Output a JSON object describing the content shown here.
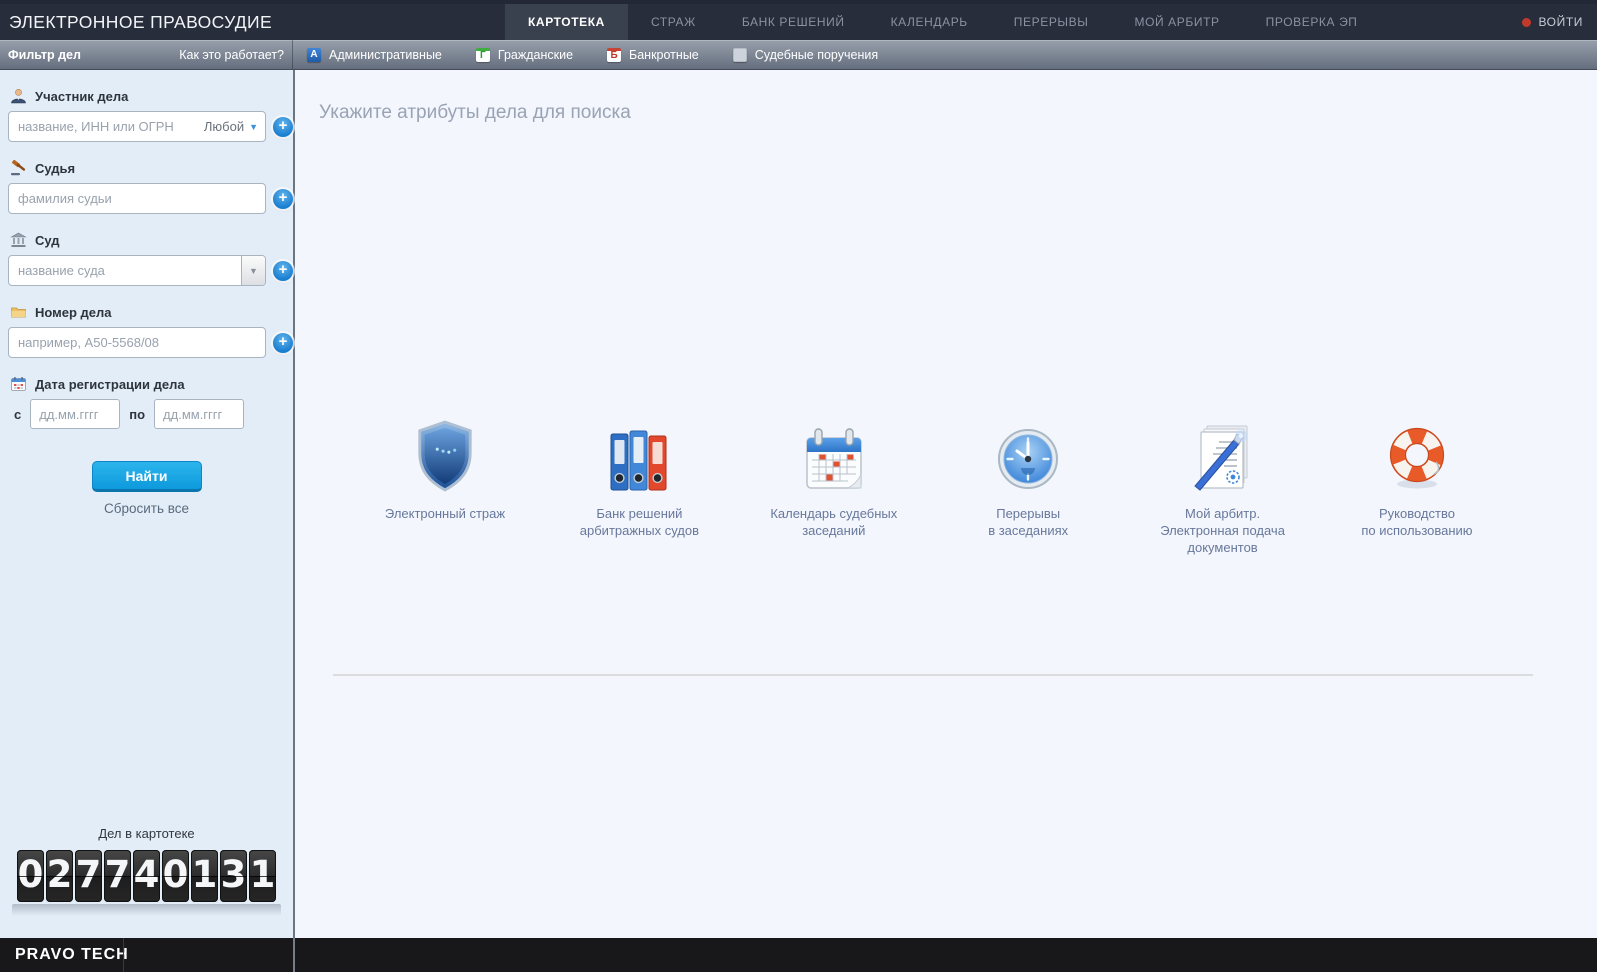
{
  "header": {
    "title": "ЭЛЕКТРОННОЕ ПРАВОСУДИЕ",
    "tabs": [
      {
        "label": "КАРТОТЕКА",
        "active": true
      },
      {
        "label": "СТРАЖ",
        "active": false
      },
      {
        "label": "БАНК РЕШЕНИЙ",
        "active": false
      },
      {
        "label": "КАЛЕНДАРЬ",
        "active": false
      },
      {
        "label": "ПЕРЕРЫВЫ",
        "active": false
      },
      {
        "label": "МОЙ АРБИТР",
        "active": false
      },
      {
        "label": "ПРОВЕРКА ЭП",
        "active": false
      }
    ],
    "login_label": "ВОЙТИ"
  },
  "filter_bar": {
    "title": "Фильтр дел",
    "help_link": "Как это работает?",
    "categories": [
      {
        "badge": "А",
        "label": "Административные",
        "color": "#2e75c8"
      },
      {
        "badge": "Г",
        "label": "Гражданские",
        "color": "#2e9b2e"
      },
      {
        "badge": "Б",
        "label": "Банкротные",
        "color": "#c0392b"
      },
      {
        "badge": "",
        "label": "Судебные поручения",
        "color": "#cdd3db"
      }
    ]
  },
  "sidebar": {
    "participant": {
      "label": "Участник дела",
      "placeholder": "название, ИНН или ОГРН",
      "type_selector": "Любой",
      "value": ""
    },
    "judge": {
      "label": "Судья",
      "placeholder": "фамилия судьи",
      "value": ""
    },
    "court": {
      "label": "Суд",
      "placeholder": "название суда",
      "value": ""
    },
    "case_number": {
      "label": "Номер дела",
      "placeholder": "например, А50-5568/08",
      "value": ""
    },
    "reg_date": {
      "label": "Дата регистрации дела",
      "from_label": "с",
      "to_label": "по",
      "date_placeholder": "дд.мм.гггг",
      "from_value": "",
      "to_value": ""
    },
    "search_button": "Найти",
    "reset_link": "Сбросить все",
    "counter": {
      "label": "Дел в картотеке",
      "digits": "027740131"
    }
  },
  "main": {
    "hint": "Укажите атрибуты дела для поиска",
    "shortcuts": [
      {
        "icon": "shield-icon",
        "label": "Электронный страж"
      },
      {
        "icon": "binders-icon",
        "label": "Банк решений\nарбитражных судов"
      },
      {
        "icon": "calendar-icon",
        "label": "Календарь судебных\nзаседаний"
      },
      {
        "icon": "clock-icon",
        "label": "Перерывы\nв заседаниях"
      },
      {
        "icon": "document-pen-icon",
        "label": "Мой арбитр.\nЭлектронная подача\nдокументов"
      },
      {
        "icon": "lifebuoy-icon",
        "label": "Руководство\nпо использованию"
      }
    ]
  },
  "footer": {
    "brand": "PRAVO TECH"
  },
  "colors": {
    "nav_bg": "#272d3a",
    "nav_active_tab": "#3a414e",
    "filter_bar_top": "#98a0ac",
    "filter_bar_bottom": "#656e7e",
    "sidebar_bg": "#e3edf8",
    "main_bg": "#f3f6fd",
    "accent_blue": "#1a9ede",
    "login_dot": "#c0392b"
  }
}
